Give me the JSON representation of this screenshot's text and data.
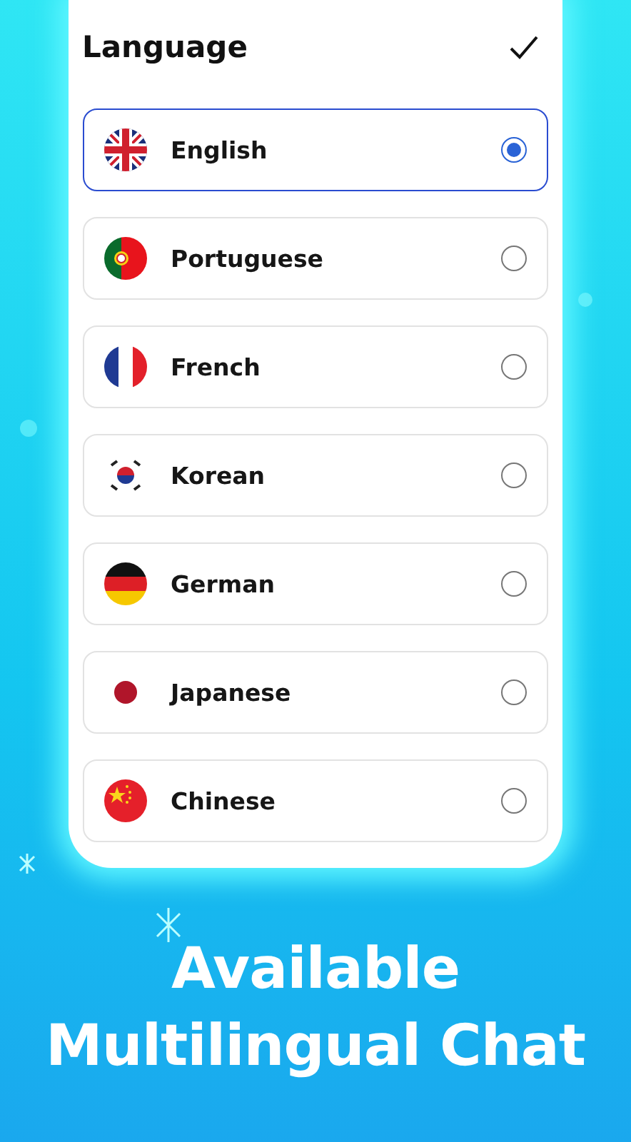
{
  "header": {
    "title": "Language"
  },
  "languages": [
    {
      "name": "English",
      "kind": "uk",
      "selected": true
    },
    {
      "name": "Portuguese",
      "kind": "pt",
      "selected": false
    },
    {
      "name": "French",
      "kind": "fr",
      "selected": false
    },
    {
      "name": "Korean",
      "kind": "kr",
      "selected": false
    },
    {
      "name": "German",
      "kind": "de",
      "selected": false
    },
    {
      "name": "Japanese",
      "kind": "jp",
      "selected": false
    },
    {
      "name": "Chinese",
      "kind": "cn",
      "selected": false
    }
  ],
  "caption": [
    "Available",
    "Multilingual Chat"
  ]
}
